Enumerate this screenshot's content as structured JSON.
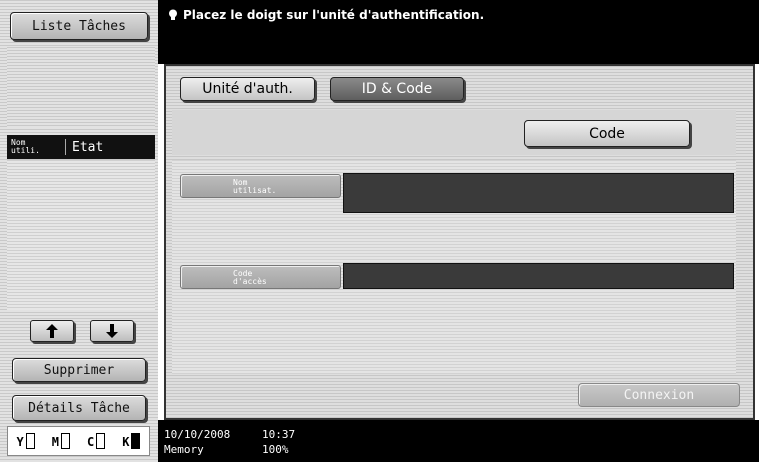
{
  "left_panel": {
    "job_list_label": "Liste Tâches",
    "columns": {
      "user": "Nom\nutili.",
      "status": "Etat"
    },
    "delete_label": "Supprimer",
    "details_label": "Détails Tâche",
    "toner": [
      {
        "label": "Y",
        "level": 0.0
      },
      {
        "label": "M",
        "level": 0.0
      },
      {
        "label": "C",
        "level": 0.0
      },
      {
        "label": "K",
        "level": 1.0
      }
    ]
  },
  "header": {
    "message": "Placez le doigt sur l'unité d'authentification."
  },
  "tabs": [
    {
      "label": "Unité d'auth.",
      "selected": false
    },
    {
      "label": "ID & Code",
      "selected": true
    }
  ],
  "code_button_label": "Code",
  "form": {
    "username_label_line1": "Nom",
    "username_label_line2": "utilisat.",
    "username_value": "",
    "password_label_line1": "Code",
    "password_label_line2": "d'accès",
    "password_value": ""
  },
  "login_label": "Connexion",
  "status_bar": {
    "date": "10/10/2008",
    "time": "10:37",
    "memory_label": "Memory",
    "memory_value": "100%"
  }
}
